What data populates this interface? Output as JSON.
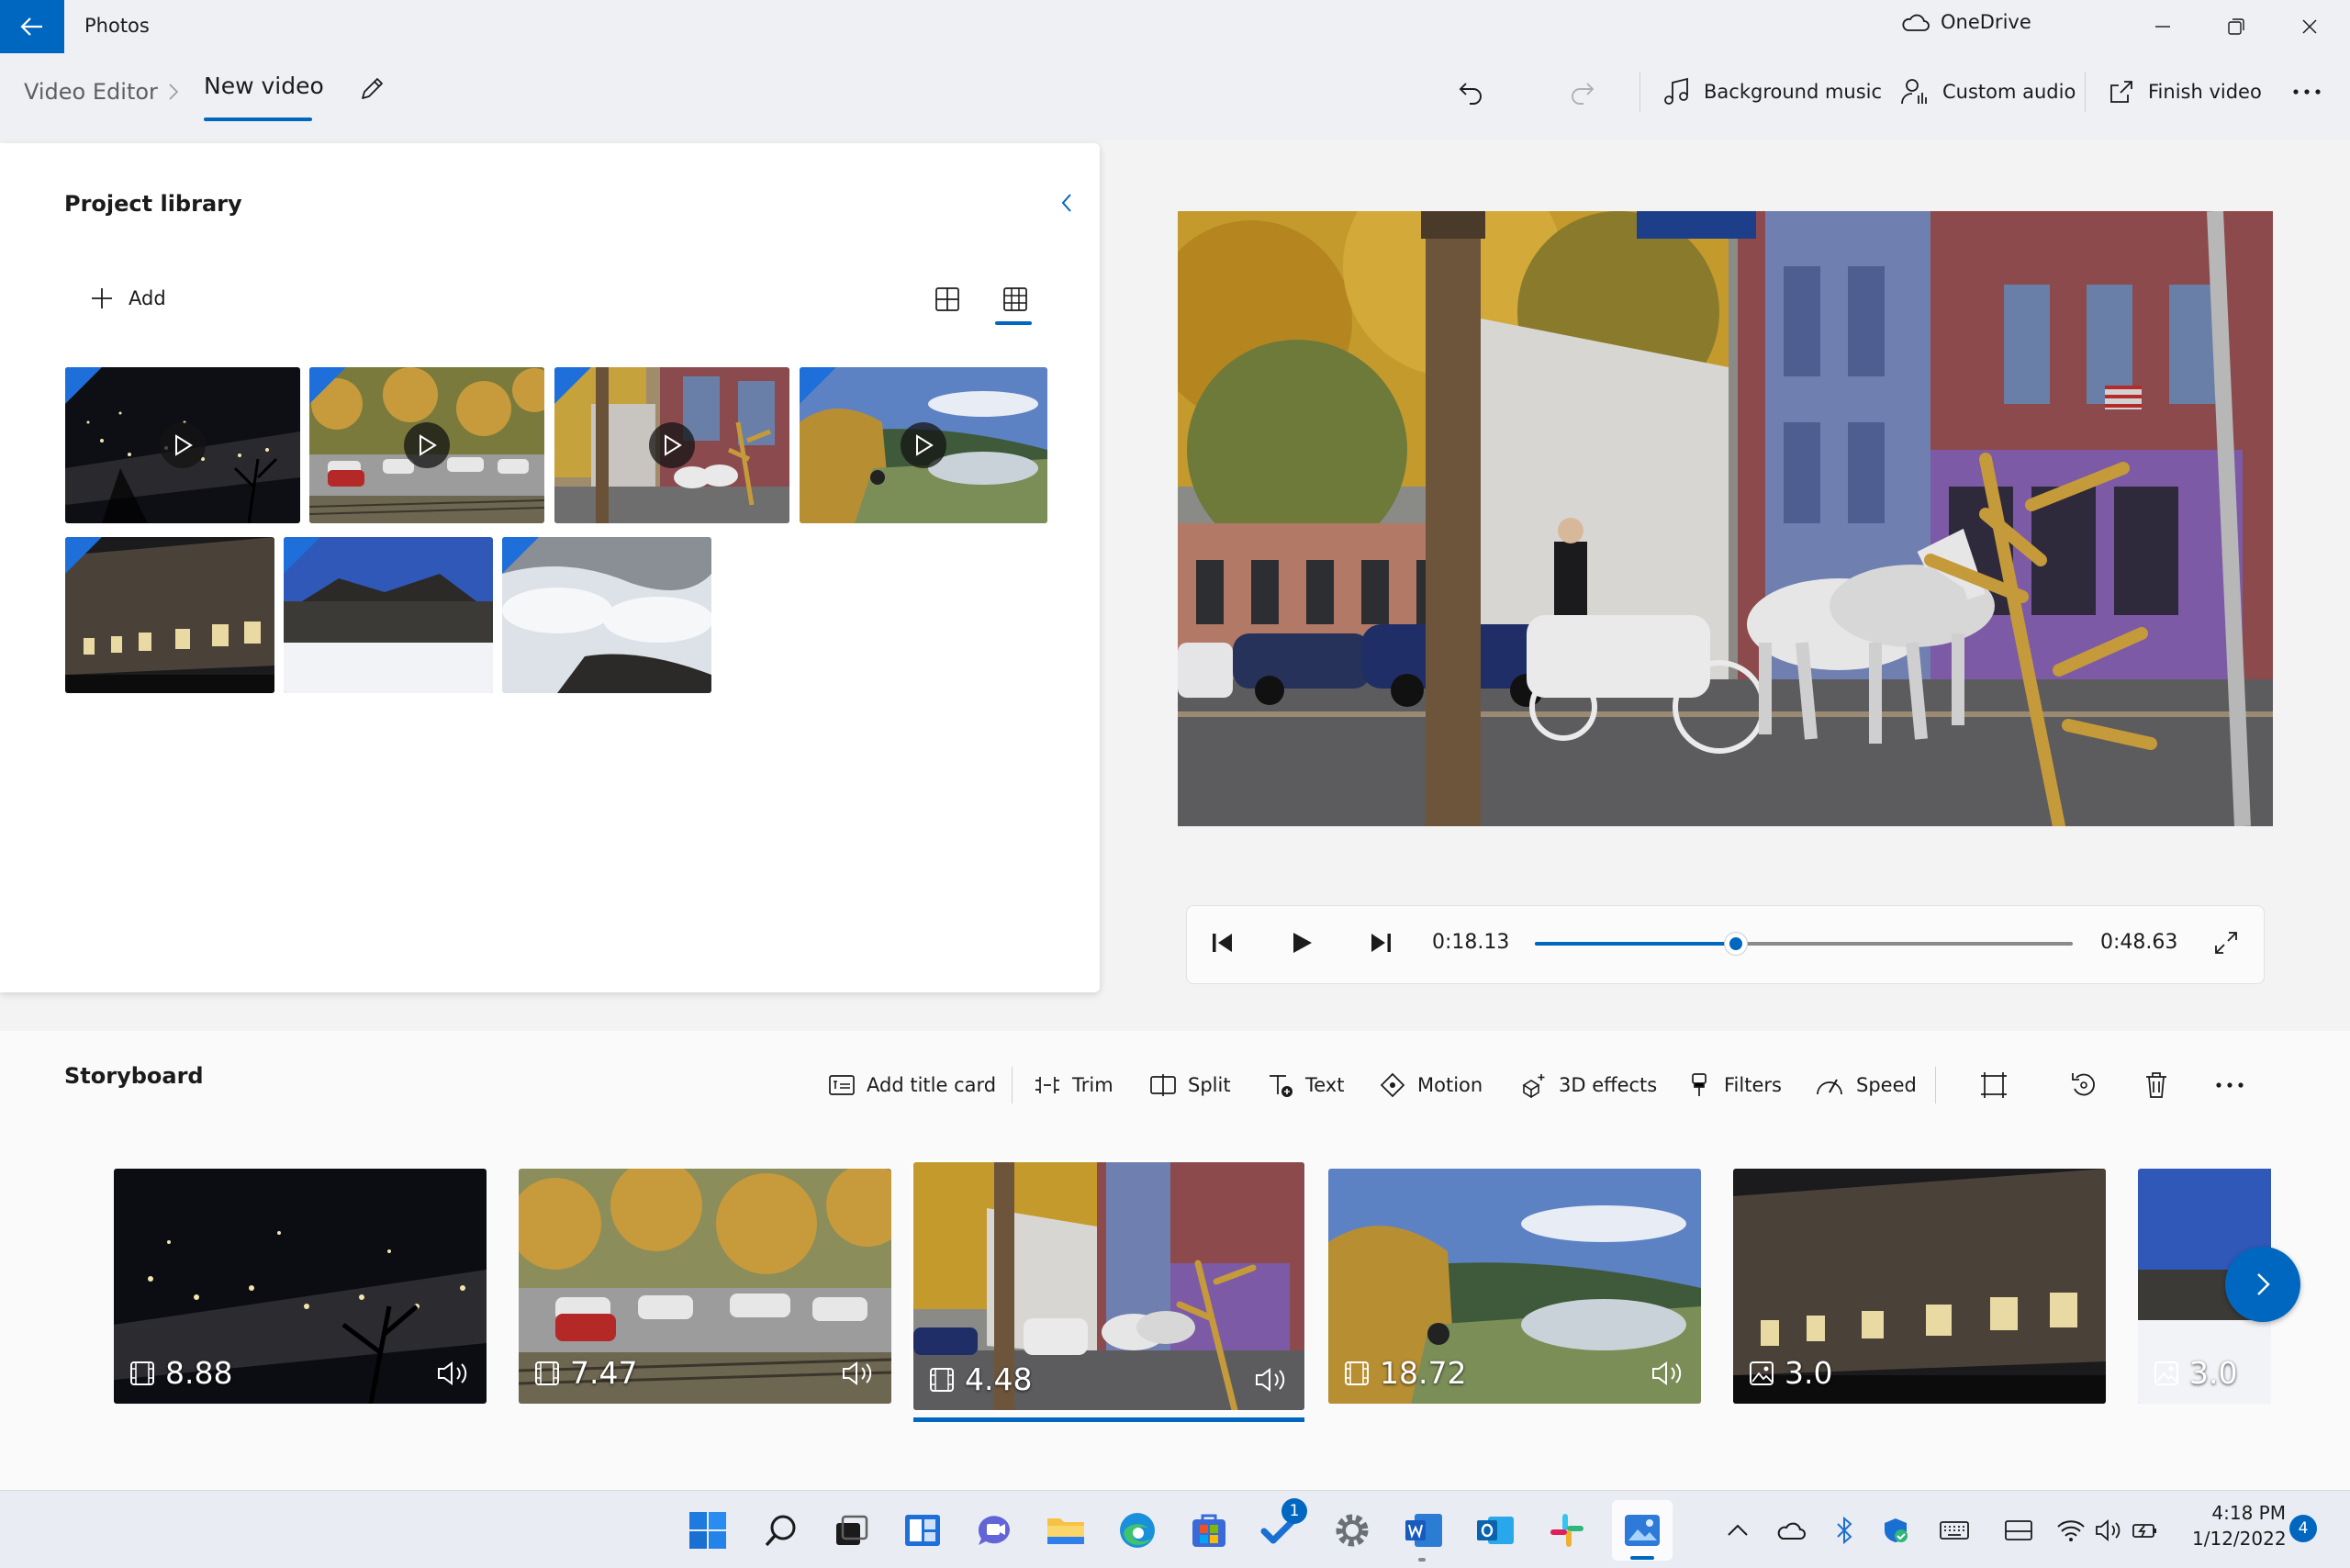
{
  "titlebar": {
    "app_title": "Photos",
    "onedrive_label": "OneDrive"
  },
  "header": {
    "breadcrumb_root": "Video Editor",
    "breadcrumb_current": "New video",
    "background_music": "Background music",
    "custom_audio": "Custom audio",
    "finish_video": "Finish video"
  },
  "library": {
    "title": "Project library",
    "add_label": "Add"
  },
  "player": {
    "current_time": "0:18.13",
    "total_time": "0:48.63",
    "progress": 0.373
  },
  "storyboard": {
    "title": "Storyboard",
    "tools": {
      "add_title_card": "Add title card",
      "trim": "Trim",
      "split": "Split",
      "text": "Text",
      "motion": "Motion",
      "effects_3d": "3D effects",
      "filters": "Filters",
      "speed": "Speed"
    },
    "clips": [
      {
        "duration": "8.88",
        "kind": "video"
      },
      {
        "duration": "7.47",
        "kind": "video"
      },
      {
        "duration": "4.48",
        "kind": "video",
        "selected": true
      },
      {
        "duration": "18.72",
        "kind": "video"
      },
      {
        "duration": "3.0",
        "kind": "image"
      },
      {
        "duration": "3.0",
        "kind": "image"
      }
    ]
  },
  "taskbar": {
    "time": "4:18 PM",
    "date": "1/12/2022",
    "notifications": "4",
    "todo_badge": "1"
  },
  "colors": {
    "accent": "#0067c0",
    "titlebar": "#eef0f4",
    "corner_tag": "#1e6fd9"
  }
}
